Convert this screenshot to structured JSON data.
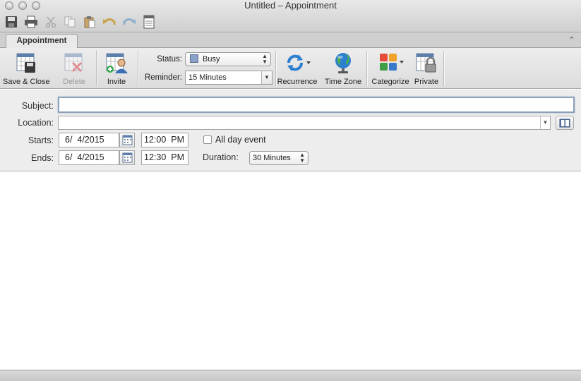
{
  "window": {
    "title": "Untitled – Appointment"
  },
  "quick_access": [
    "save-icon",
    "print-icon",
    "cut-icon",
    "copy-icon",
    "paste-icon",
    "undo-icon",
    "redo-icon",
    "calendar-sheet-icon"
  ],
  "ribbon": {
    "tab": "Appointment",
    "save_close_label": "Save & Close",
    "delete_label": "Delete",
    "invite_label": "Invite",
    "status_label": "Status:",
    "status_value": "Busy",
    "reminder_label": "Reminder:",
    "reminder_value": "15 Minutes",
    "recurrence_label": "Recurrence",
    "timezone_label": "Time Zone",
    "categorize_label": "Categorize",
    "private_label": "Private"
  },
  "form": {
    "subject_label": "Subject:",
    "subject_value": "",
    "location_label": "Location:",
    "location_value": "",
    "starts_label": "Starts:",
    "start_date": "6/  4/2015",
    "start_time": "12:00  PM",
    "all_day_label": "All day event",
    "all_day_checked": false,
    "ends_label": "Ends:",
    "end_date": "6/  4/2015",
    "end_time": "12:30  PM",
    "duration_label": "Duration:",
    "duration_value": "30 Minutes"
  },
  "colors": {
    "busy_swatch": "#8aa2c8",
    "accent_blue": "#2f7fd0"
  }
}
